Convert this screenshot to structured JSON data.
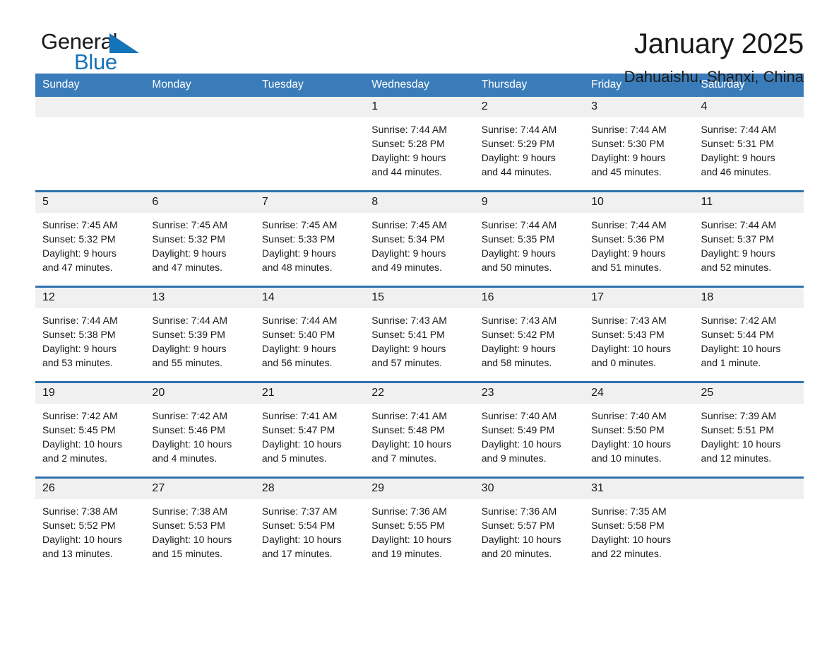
{
  "brand": {
    "name_top": "General",
    "name_bottom": "Blue",
    "accent_color": "#1573b9"
  },
  "header": {
    "title": "January 2025",
    "location": "Dahuaishu, Shanxi, China"
  },
  "theme": {
    "header_bar_color": "#3a7cb9",
    "row_divider_color": "#2f73ae",
    "daynum_band_color": "#f0f0f0",
    "text_color": "#1a1a1a"
  },
  "weekday_headers": [
    "Sunday",
    "Monday",
    "Tuesday",
    "Wednesday",
    "Thursday",
    "Friday",
    "Saturday"
  ],
  "weeks": [
    [
      {
        "day": "",
        "sunrise": "",
        "sunset": "",
        "daylight_1": "",
        "daylight_2": "",
        "empty": true
      },
      {
        "day": "",
        "sunrise": "",
        "sunset": "",
        "daylight_1": "",
        "daylight_2": "",
        "empty": true
      },
      {
        "day": "",
        "sunrise": "",
        "sunset": "",
        "daylight_1": "",
        "daylight_2": "",
        "empty": true
      },
      {
        "day": "1",
        "sunrise": "Sunrise: 7:44 AM",
        "sunset": "Sunset: 5:28 PM",
        "daylight_1": "Daylight: 9 hours",
        "daylight_2": "and 44 minutes.",
        "empty": false
      },
      {
        "day": "2",
        "sunrise": "Sunrise: 7:44 AM",
        "sunset": "Sunset: 5:29 PM",
        "daylight_1": "Daylight: 9 hours",
        "daylight_2": "and 44 minutes.",
        "empty": false
      },
      {
        "day": "3",
        "sunrise": "Sunrise: 7:44 AM",
        "sunset": "Sunset: 5:30 PM",
        "daylight_1": "Daylight: 9 hours",
        "daylight_2": "and 45 minutes.",
        "empty": false
      },
      {
        "day": "4",
        "sunrise": "Sunrise: 7:44 AM",
        "sunset": "Sunset: 5:31 PM",
        "daylight_1": "Daylight: 9 hours",
        "daylight_2": "and 46 minutes.",
        "empty": false
      }
    ],
    [
      {
        "day": "5",
        "sunrise": "Sunrise: 7:45 AM",
        "sunset": "Sunset: 5:32 PM",
        "daylight_1": "Daylight: 9 hours",
        "daylight_2": "and 47 minutes.",
        "empty": false
      },
      {
        "day": "6",
        "sunrise": "Sunrise: 7:45 AM",
        "sunset": "Sunset: 5:32 PM",
        "daylight_1": "Daylight: 9 hours",
        "daylight_2": "and 47 minutes.",
        "empty": false
      },
      {
        "day": "7",
        "sunrise": "Sunrise: 7:45 AM",
        "sunset": "Sunset: 5:33 PM",
        "daylight_1": "Daylight: 9 hours",
        "daylight_2": "and 48 minutes.",
        "empty": false
      },
      {
        "day": "8",
        "sunrise": "Sunrise: 7:45 AM",
        "sunset": "Sunset: 5:34 PM",
        "daylight_1": "Daylight: 9 hours",
        "daylight_2": "and 49 minutes.",
        "empty": false
      },
      {
        "day": "9",
        "sunrise": "Sunrise: 7:44 AM",
        "sunset": "Sunset: 5:35 PM",
        "daylight_1": "Daylight: 9 hours",
        "daylight_2": "and 50 minutes.",
        "empty": false
      },
      {
        "day": "10",
        "sunrise": "Sunrise: 7:44 AM",
        "sunset": "Sunset: 5:36 PM",
        "daylight_1": "Daylight: 9 hours",
        "daylight_2": "and 51 minutes.",
        "empty": false
      },
      {
        "day": "11",
        "sunrise": "Sunrise: 7:44 AM",
        "sunset": "Sunset: 5:37 PM",
        "daylight_1": "Daylight: 9 hours",
        "daylight_2": "and 52 minutes.",
        "empty": false
      }
    ],
    [
      {
        "day": "12",
        "sunrise": "Sunrise: 7:44 AM",
        "sunset": "Sunset: 5:38 PM",
        "daylight_1": "Daylight: 9 hours",
        "daylight_2": "and 53 minutes.",
        "empty": false
      },
      {
        "day": "13",
        "sunrise": "Sunrise: 7:44 AM",
        "sunset": "Sunset: 5:39 PM",
        "daylight_1": "Daylight: 9 hours",
        "daylight_2": "and 55 minutes.",
        "empty": false
      },
      {
        "day": "14",
        "sunrise": "Sunrise: 7:44 AM",
        "sunset": "Sunset: 5:40 PM",
        "daylight_1": "Daylight: 9 hours",
        "daylight_2": "and 56 minutes.",
        "empty": false
      },
      {
        "day": "15",
        "sunrise": "Sunrise: 7:43 AM",
        "sunset": "Sunset: 5:41 PM",
        "daylight_1": "Daylight: 9 hours",
        "daylight_2": "and 57 minutes.",
        "empty": false
      },
      {
        "day": "16",
        "sunrise": "Sunrise: 7:43 AM",
        "sunset": "Sunset: 5:42 PM",
        "daylight_1": "Daylight: 9 hours",
        "daylight_2": "and 58 minutes.",
        "empty": false
      },
      {
        "day": "17",
        "sunrise": "Sunrise: 7:43 AM",
        "sunset": "Sunset: 5:43 PM",
        "daylight_1": "Daylight: 10 hours",
        "daylight_2": "and 0 minutes.",
        "empty": false
      },
      {
        "day": "18",
        "sunrise": "Sunrise: 7:42 AM",
        "sunset": "Sunset: 5:44 PM",
        "daylight_1": "Daylight: 10 hours",
        "daylight_2": "and 1 minute.",
        "empty": false
      }
    ],
    [
      {
        "day": "19",
        "sunrise": "Sunrise: 7:42 AM",
        "sunset": "Sunset: 5:45 PM",
        "daylight_1": "Daylight: 10 hours",
        "daylight_2": "and 2 minutes.",
        "empty": false
      },
      {
        "day": "20",
        "sunrise": "Sunrise: 7:42 AM",
        "sunset": "Sunset: 5:46 PM",
        "daylight_1": "Daylight: 10 hours",
        "daylight_2": "and 4 minutes.",
        "empty": false
      },
      {
        "day": "21",
        "sunrise": "Sunrise: 7:41 AM",
        "sunset": "Sunset: 5:47 PM",
        "daylight_1": "Daylight: 10 hours",
        "daylight_2": "and 5 minutes.",
        "empty": false
      },
      {
        "day": "22",
        "sunrise": "Sunrise: 7:41 AM",
        "sunset": "Sunset: 5:48 PM",
        "daylight_1": "Daylight: 10 hours",
        "daylight_2": "and 7 minutes.",
        "empty": false
      },
      {
        "day": "23",
        "sunrise": "Sunrise: 7:40 AM",
        "sunset": "Sunset: 5:49 PM",
        "daylight_1": "Daylight: 10 hours",
        "daylight_2": "and 9 minutes.",
        "empty": false
      },
      {
        "day": "24",
        "sunrise": "Sunrise: 7:40 AM",
        "sunset": "Sunset: 5:50 PM",
        "daylight_1": "Daylight: 10 hours",
        "daylight_2": "and 10 minutes.",
        "empty": false
      },
      {
        "day": "25",
        "sunrise": "Sunrise: 7:39 AM",
        "sunset": "Sunset: 5:51 PM",
        "daylight_1": "Daylight: 10 hours",
        "daylight_2": "and 12 minutes.",
        "empty": false
      }
    ],
    [
      {
        "day": "26",
        "sunrise": "Sunrise: 7:38 AM",
        "sunset": "Sunset: 5:52 PM",
        "daylight_1": "Daylight: 10 hours",
        "daylight_2": "and 13 minutes.",
        "empty": false
      },
      {
        "day": "27",
        "sunrise": "Sunrise: 7:38 AM",
        "sunset": "Sunset: 5:53 PM",
        "daylight_1": "Daylight: 10 hours",
        "daylight_2": "and 15 minutes.",
        "empty": false
      },
      {
        "day": "28",
        "sunrise": "Sunrise: 7:37 AM",
        "sunset": "Sunset: 5:54 PM",
        "daylight_1": "Daylight: 10 hours",
        "daylight_2": "and 17 minutes.",
        "empty": false
      },
      {
        "day": "29",
        "sunrise": "Sunrise: 7:36 AM",
        "sunset": "Sunset: 5:55 PM",
        "daylight_1": "Daylight: 10 hours",
        "daylight_2": "and 19 minutes.",
        "empty": false
      },
      {
        "day": "30",
        "sunrise": "Sunrise: 7:36 AM",
        "sunset": "Sunset: 5:57 PM",
        "daylight_1": "Daylight: 10 hours",
        "daylight_2": "and 20 minutes.",
        "empty": false
      },
      {
        "day": "31",
        "sunrise": "Sunrise: 7:35 AM",
        "sunset": "Sunset: 5:58 PM",
        "daylight_1": "Daylight: 10 hours",
        "daylight_2": "and 22 minutes.",
        "empty": false
      },
      {
        "day": "",
        "sunrise": "",
        "sunset": "",
        "daylight_1": "",
        "daylight_2": "",
        "empty": true
      }
    ]
  ]
}
